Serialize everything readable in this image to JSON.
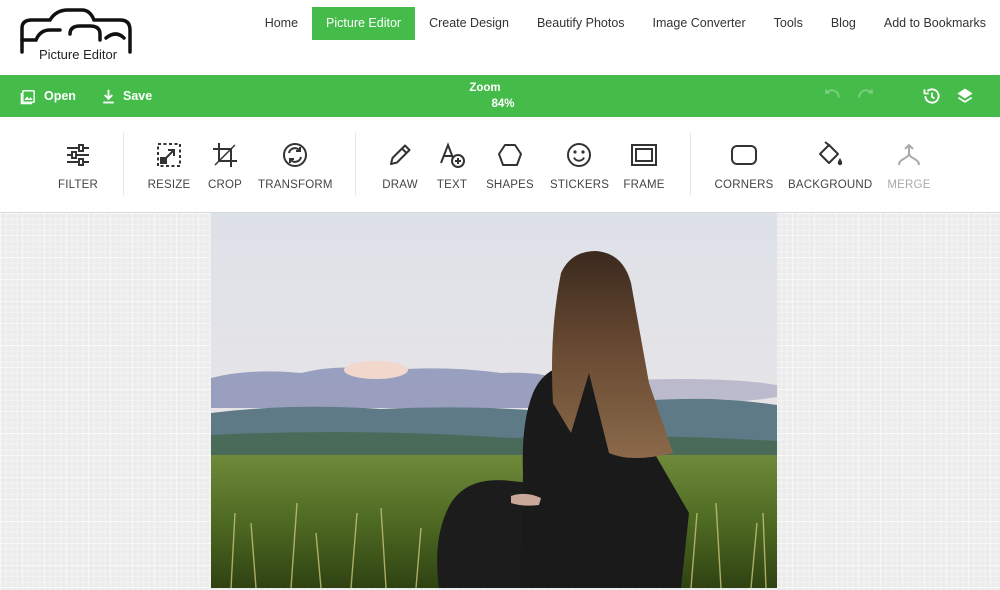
{
  "logo": {
    "text": "Picture Editor"
  },
  "nav": {
    "items": [
      {
        "label": "Home"
      },
      {
        "label": "Picture Editor",
        "active": true
      },
      {
        "label": "Create Design"
      },
      {
        "label": "Beautify Photos"
      },
      {
        "label": "Image Converter"
      },
      {
        "label": "Tools"
      },
      {
        "label": "Blog"
      },
      {
        "label": "Add to Bookmarks"
      }
    ]
  },
  "actionbar": {
    "open_label": "Open",
    "save_label": "Save",
    "zoom_label": "Zoom",
    "zoom_value": "84%"
  },
  "tools": {
    "filter": "FILTER",
    "resize": "RESIZE",
    "crop": "CROP",
    "transform": "TRANSFORM",
    "draw": "DRAW",
    "text": "TEXT",
    "shapes": "SHAPES",
    "stickers": "STICKERS",
    "frame": "FRAME",
    "corners": "CORNERS",
    "background": "BACKGROUND",
    "merge": "MERGE"
  },
  "colors": {
    "accent": "#45bc4a",
    "disabled": "#aaaaaa"
  }
}
